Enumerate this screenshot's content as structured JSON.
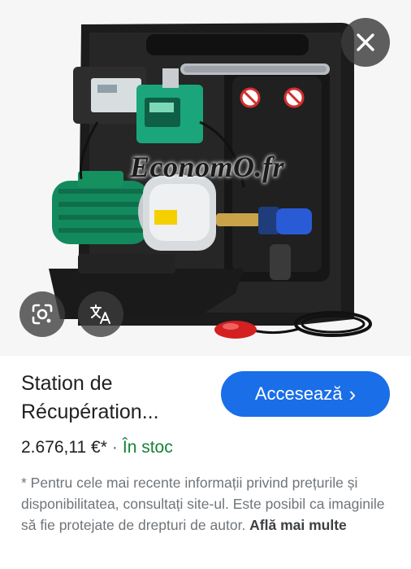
{
  "image": {
    "watermark": "EconomO.fr"
  },
  "controls": {
    "close_icon": "close-icon",
    "lens_icon": "google-lens-icon",
    "translate_icon": "translate-icon"
  },
  "product": {
    "title": "Station de Récupération...",
    "price": "2.676,11 €*",
    "separator": "·",
    "stock": "În stoc",
    "visit_label": "Accesează",
    "visit_chevron": "›"
  },
  "disclaimer": {
    "text": "* Pentru cele mai recente informații privind prețurile și disponibilitatea, consultați site-ul. Este posibil ca imaginile să fie protejate de drepturi de autor.",
    "link": "Află mai multe"
  },
  "colors": {
    "accent": "#1a6ee8",
    "in_stock": "#188038"
  }
}
